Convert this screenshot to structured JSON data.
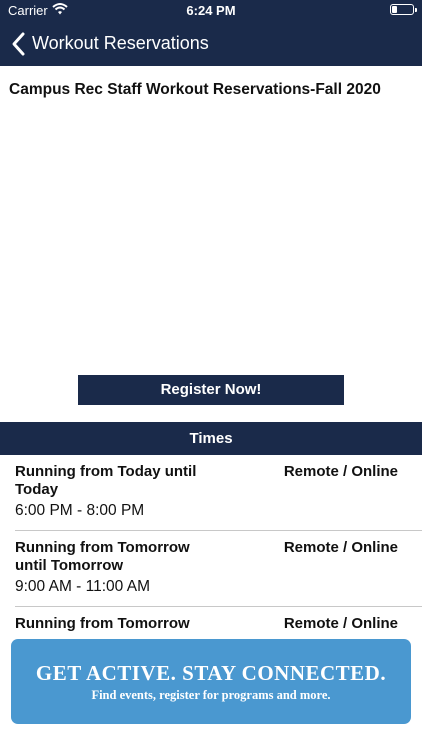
{
  "status_bar": {
    "carrier": "Carrier",
    "time": "6:24 PM"
  },
  "nav": {
    "title": "Workout Reservations"
  },
  "page": {
    "title": "Campus Rec Staff Workout Reservations-Fall 2020"
  },
  "register_button": {
    "label": "Register Now!"
  },
  "times": {
    "header": "Times",
    "rows": [
      {
        "when": "Running from Today until Today",
        "hours": "6:00 PM - 8:00 PM",
        "location": "Remote / Online"
      },
      {
        "when": "Running from Tomorrow until Tomorrow",
        "hours": "9:00 AM - 11:00 AM",
        "location": "Remote / Online"
      },
      {
        "when": "Running from Tomorrow",
        "hours": "",
        "location": "Remote / Online"
      }
    ]
  },
  "banner": {
    "headline": "GET ACTIVE.  STAY CONNECTED.",
    "subtext": "Find events, register for programs and more."
  }
}
